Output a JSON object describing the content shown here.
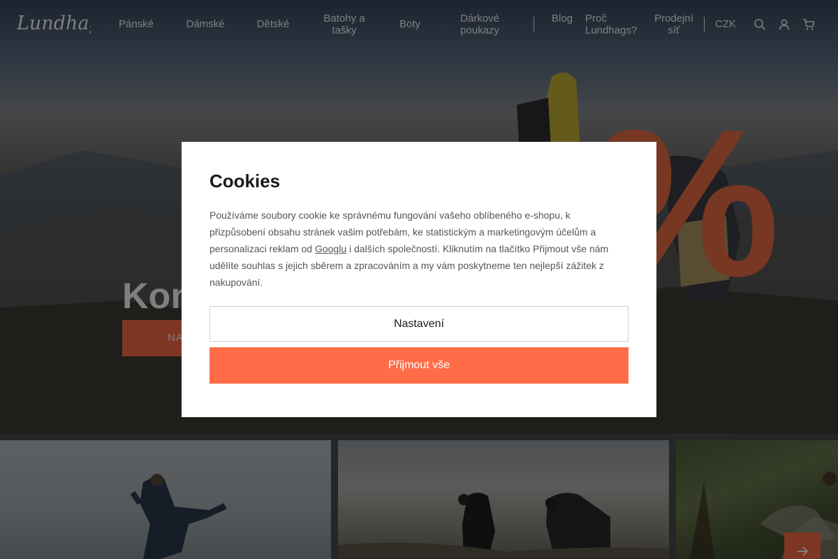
{
  "header": {
    "logo_text": "Lundhags",
    "nav": [
      {
        "label": "Pánské"
      },
      {
        "label": "Dámské"
      },
      {
        "label": "Dětské"
      },
      {
        "label": "Batohy a tašky"
      },
      {
        "label": "Boty"
      },
      {
        "label": "Dárkové poukazy"
      },
      {
        "label": "Blog"
      },
      {
        "label": "Proč Lundhags?"
      },
      {
        "label": "Prodejní síť"
      }
    ],
    "currency": "CZK",
    "icons": [
      "search-icon",
      "account-icon",
      "cart-icon"
    ]
  },
  "hero": {
    "headline_visible": "Kon                                        eje",
    "cta_visible": "NA",
    "decoration": "%"
  },
  "carousel": {
    "next_icon": "arrow-right-icon"
  },
  "cookie_modal": {
    "title": "Cookies",
    "text_before_link": "Používáme soubory cookie ke správnému fungování vašeho oblíbeného e-shopu, k přizpůsobení obsahu stránek vašim potřebám, ke statistickým a marketingovým účelům a personalizaci reklam od ",
    "link_text": "Googlu",
    "text_after_link": " i dalších společností. Kliknutím na tlačítko Přijmout vše nám udělíte souhlas s jejich sběrem a zpracováním a my vám poskytneme ten nejlepší zážitek z nakupování.",
    "settings_label": "Nastavení",
    "accept_label": "Přijmout vše"
  },
  "colors": {
    "accent": "#ff6c47",
    "overlay": "rgba(0,0,0,0.5)",
    "modal_bg": "#ffffff"
  }
}
